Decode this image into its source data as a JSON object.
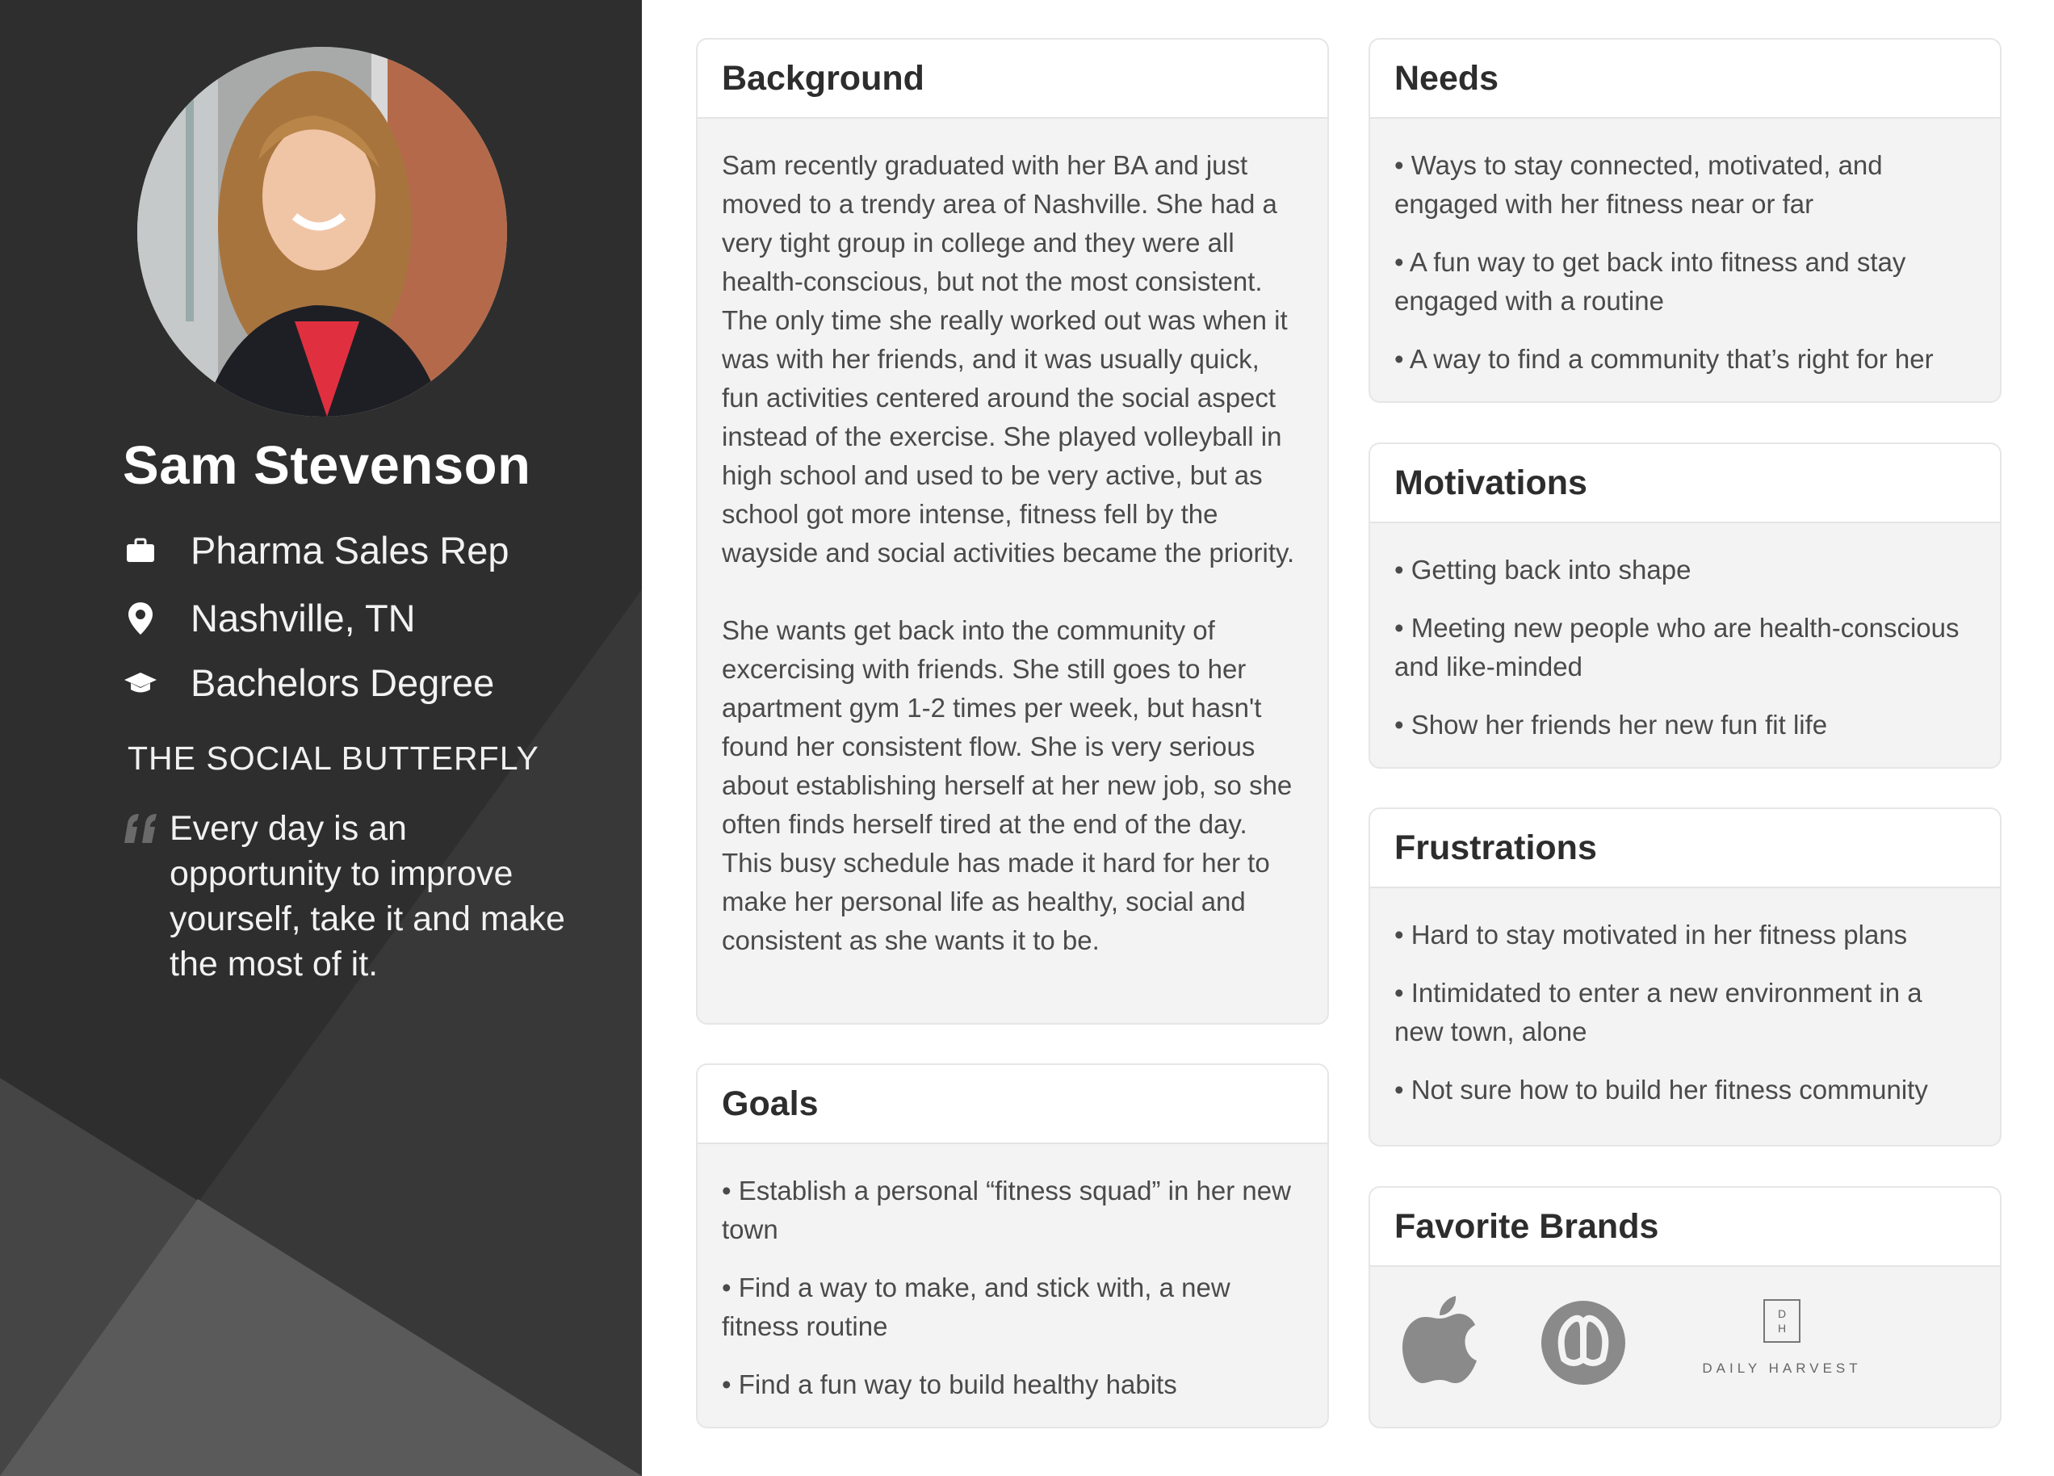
{
  "profile": {
    "name": "Sam Stevenson",
    "occupation": "Pharma Sales Rep",
    "location": "Nashville, TN",
    "education": "Bachelors Degree",
    "tagline": "THE SOCIAL BUTTERFLY",
    "quote": "Every day is an opportunity to improve yourself, take it and make the most of it.",
    "icons": {
      "occupation": "briefcase-icon",
      "location": "map-pin-icon",
      "education": "graduation-cap-icon",
      "quote": "quote-icon"
    }
  },
  "background": {
    "title": "Background",
    "paragraphs": [
      "Sam recently graduated with her BA and just moved to a trendy area of Nashville. She had a very tight group in college and they were all health-conscious, but not the most consistent. The only time she really worked out was when it was with her friends, and it was usually quick, fun activities centered around the social aspect instead of the exercise. She played volleyball in high school and used to be very active, but as school got more intense, fitness fell by the wayside and social activities became the priority.",
      "She wants get back into the community of excercising with friends. She still goes to her apartment gym 1-2 times per week, but hasn't found her consistent flow. She is very serious about establishing herself at her new job, so she often finds herself tired at the end of the day. This busy schedule has made it hard for her to make her personal life as healthy, social and consistent as she wants it to be."
    ]
  },
  "goals": {
    "title": "Goals",
    "items": [
      "• Establish a personal “fitness squad” in her new town",
      "• Find a way to make, and stick with, a new fitness routine",
      "• Find a fun way to build healthy habits"
    ]
  },
  "needs": {
    "title": "Needs",
    "items": [
      "• Ways to stay connected, motivated, and engaged with her fitness near or far",
      "• A fun way to get back into fitness and stay engaged with a routine",
      "• A way to find a community that’s right for her"
    ]
  },
  "motivations": {
    "title": "Motivations",
    "items": [
      "• Getting back into shape",
      "• Meeting new people who are health-conscious and like-minded",
      "• Show her friends her new fun fit life"
    ]
  },
  "frustrations": {
    "title": "Frustrations",
    "items": [
      "• Hard to stay motivated in her fitness plans",
      "• Intimidated to enter a new environment in a new town, alone",
      "• Not sure how to build her fitness community"
    ]
  },
  "brands": {
    "title": "Favorite Brands",
    "dh_mark_top": "D",
    "dh_mark_bottom": "H",
    "dh_name": "DAILY HARVEST",
    "logos": [
      "apple-logo-icon",
      "lululemon-logo-icon",
      "daily-harvest-logo"
    ]
  }
}
